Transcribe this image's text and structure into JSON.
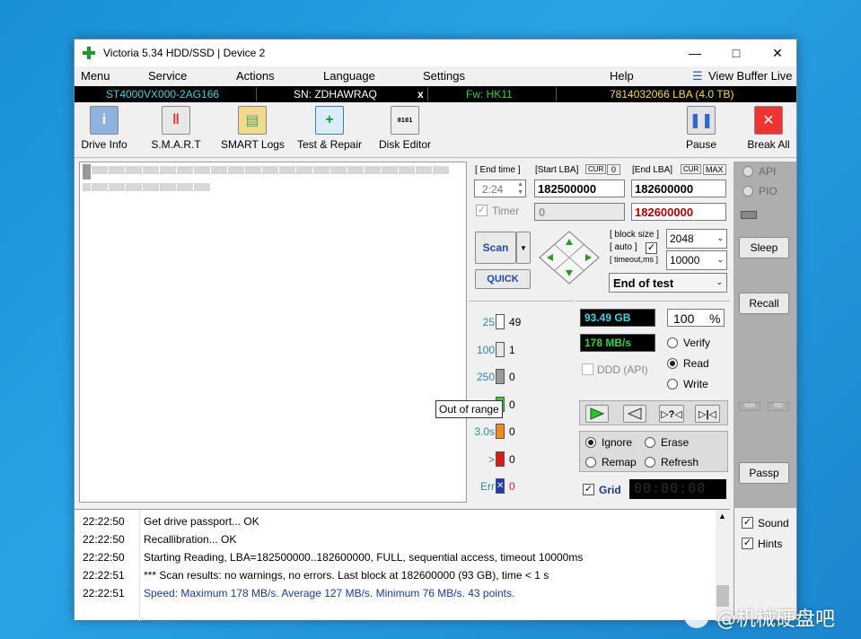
{
  "window": {
    "title": "Victoria 5.34 HDD/SSD | Device 2"
  },
  "menu": {
    "items": [
      "Menu",
      "Service",
      "Actions",
      "Language",
      "Settings",
      "Help"
    ],
    "view_buffer": "View Buffer Live"
  },
  "info": {
    "model": "ST4000VX000-2AG166",
    "sn": "SN: ZDHAWRAQ",
    "x": "x",
    "fw": "Fw: HK11",
    "lba": "7814032066 LBA (4.0 TB)"
  },
  "toolbar": {
    "drive_info": "Drive Info",
    "smart": "S.M.A.R.T",
    "smart_logs": "SMART Logs",
    "test_repair": "Test & Repair",
    "disk_editor": "Disk Editor",
    "pause": "Pause",
    "break_all": "Break All"
  },
  "scan": {
    "end_time_label": "[ End time ]",
    "end_time": "2:24",
    "start_lba_label": "[Start LBA]",
    "cur": "CUR",
    "zero": "0",
    "end_lba_label": "[End LBA]",
    "max": "MAX",
    "start_lba": "182500000",
    "end_lba": "182600000",
    "timer_label": "Timer",
    "timer_value": "0",
    "end_lba_current": "182600000",
    "scan_btn": "Scan",
    "quick_btn": "QUICK",
    "block_size_label": "[ block size ]",
    "auto_label": "[ auto ]",
    "timeout_label": "[ timeout,ms ]",
    "block_size": "2048",
    "timeout": "10000",
    "end_action": "End of test"
  },
  "stats": {
    "rows": [
      {
        "label": "25",
        "count": "49"
      },
      {
        "label": "100",
        "count": "1"
      },
      {
        "label": "250",
        "count": "0"
      },
      {
        "label": "",
        "count": "0"
      },
      {
        "label": "3.0s",
        "count": "0"
      },
      {
        "label": ">",
        "count": "0"
      },
      {
        "label": "Err",
        "count": "0"
      }
    ],
    "tooltip": "Out of range"
  },
  "progress": {
    "gb": "93.49 GB",
    "percent": "100",
    "pct_sign": "%",
    "speed": "178 MB/s",
    "ddd": "DDD (API)"
  },
  "mode": {
    "verify": "Verify",
    "read": "Read",
    "write": "Write"
  },
  "repair": {
    "ignore": "Ignore",
    "erase": "Erase",
    "remap": "Remap",
    "refresh": "Refresh"
  },
  "grid": {
    "label": "Grid",
    "clock": "00:00:00"
  },
  "side": {
    "api": "API",
    "pio": "PIO",
    "sleep": "Sleep",
    "recall": "Recall",
    "wr": "WR",
    "rd": "RD",
    "passp": "Passp",
    "sound": "Sound",
    "hints": "Hints"
  },
  "log": [
    {
      "time": "22:22:50",
      "msg": "Get drive passport... OK",
      "color": "#000000"
    },
    {
      "time": "22:22:50",
      "msg": "Recallibration... OK",
      "color": "#000000"
    },
    {
      "time": "22:22:50",
      "msg": "Starting Reading, LBA=182500000..182600000, FULL, sequential access, timeout 10000ms",
      "color": "#000000"
    },
    {
      "time": "22:22:51",
      "msg": "*** Scan results: no warnings, no errors. Last block at 182600000 (93 GB), time  < 1 s",
      "color": "#000000"
    },
    {
      "time": "22:22:51",
      "msg": "Speed: Maximum 178 MB/s. Average 127 MB/s. Minimum 76 MB/s. 43 points.",
      "color": "#1a3aa8"
    }
  ],
  "watermark": "@机械硬盘吧"
}
